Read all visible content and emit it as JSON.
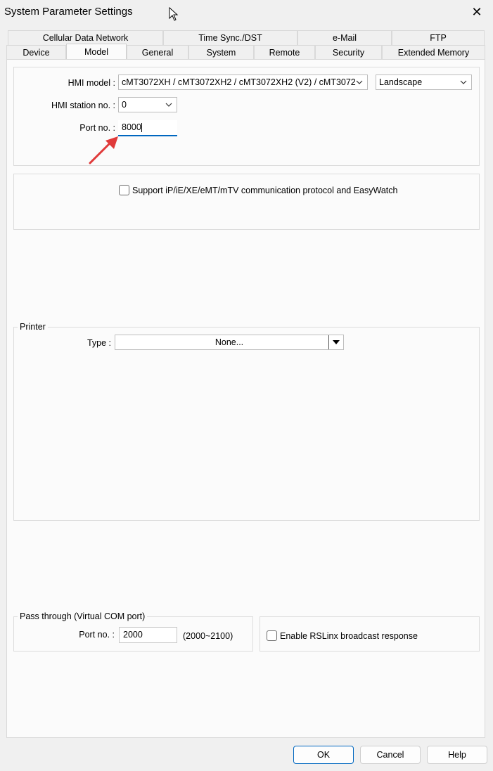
{
  "window": {
    "title": "System Parameter Settings"
  },
  "tabs_row1": [
    {
      "label": "Cellular Data Network"
    },
    {
      "label": "Time Sync./DST"
    },
    {
      "label": "e-Mail"
    },
    {
      "label": "FTP"
    }
  ],
  "tabs_row2": [
    {
      "label": "Device"
    },
    {
      "label": "Model"
    },
    {
      "label": "General"
    },
    {
      "label": "System"
    },
    {
      "label": "Remote"
    },
    {
      "label": "Security"
    },
    {
      "label": "Extended Memory"
    }
  ],
  "model": {
    "hmi_model_label": "HMI model :",
    "hmi_model_value": "cMT3072XH / cMT3072XH2 / cMT3072XH2 (V2) / cMT3072",
    "orientation_value": "Landscape",
    "station_label": "HMI station no. :",
    "station_value": "0",
    "port_label": "Port no. :",
    "port_value": "8000"
  },
  "protocol": {
    "support_label": "Support iP/iE/XE/eMT/mTV communication protocol and EasyWatch",
    "support_checked": false
  },
  "printer": {
    "group_label": "Printer",
    "type_label": "Type :",
    "type_value": "None..."
  },
  "pass_through": {
    "group_label": "Pass through (Virtual COM port)",
    "port_label": "Port no. :",
    "port_value": "2000",
    "range": "(2000~2100)"
  },
  "rslinx": {
    "label": "Enable RSLinx broadcast response",
    "checked": false
  },
  "buttons": {
    "ok": "OK",
    "cancel": "Cancel",
    "help": "Help"
  },
  "colors": {
    "accent": "#0067c0",
    "arrow": "#e03a3a"
  },
  "icons": {
    "close": "close-icon",
    "cursor": "mouse-cursor-icon",
    "dropdown": "chevron-down-icon",
    "arrow": "red-arrow-icon"
  }
}
